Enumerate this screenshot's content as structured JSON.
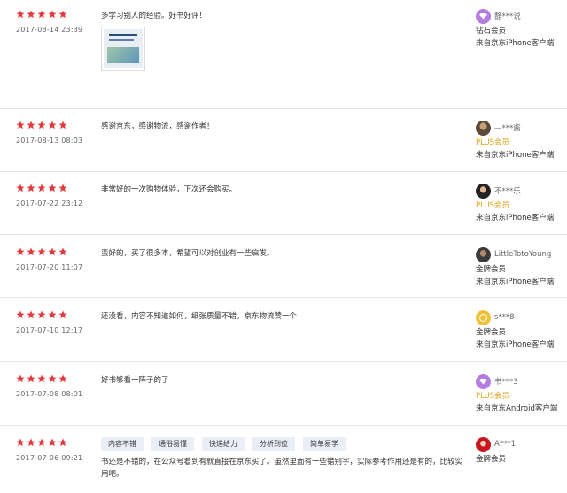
{
  "colors": {
    "star": "#e4393c",
    "plus": "#e3a120",
    "tag_bg": "#eaeef7"
  },
  "reviews": [
    {
      "stars": 5,
      "date": "2017-08-14 23:39",
      "content": "多学习别人的经验。好书好评！",
      "has_image": true,
      "user": {
        "name": "静***说",
        "avatar": "diamond-icon",
        "level": "钻石会员",
        "device": "来自京东iPhone客户端"
      }
    },
    {
      "stars": 5,
      "date": "2017-08-13 08:03",
      "content": "感谢京东，感谢物流，感谢作者！",
      "user": {
        "name": "—***酱",
        "avatar": "user-photo",
        "level": "PLUS会员",
        "device": "来自京东iPhone客户端"
      }
    },
    {
      "stars": 5,
      "date": "2017-07-22 23:12",
      "content": "非常好的一次购物体验，下次还会购买。",
      "user": {
        "name": "不***乐",
        "avatar": "user-photo",
        "level": "PLUS会员",
        "device": "来自京东iPhone客户端"
      }
    },
    {
      "stars": 5,
      "date": "2017-07-20 11:07",
      "content": "蛮好的，买了很多本，希望可以对创业有一些启发。",
      "user": {
        "name": "LittleTotoYoung",
        "avatar": "user-photo",
        "level": "金牌会员",
        "device": "来自京东iPhone客户端"
      }
    },
    {
      "stars": 5,
      "date": "2017-07-10 12:17",
      "content": "还没看，内容不知道如何，纸张质量不错，京东物流赞一个",
      "user": {
        "name": "s***8",
        "avatar": "gold-coin-icon",
        "level": "金牌会员",
        "device": "来自京东iPhone客户端"
      }
    },
    {
      "stars": 5,
      "date": "2017-07-08 08:01",
      "content": "好书够看一阵子的了",
      "user": {
        "name": "书***3",
        "avatar": "diamond-icon",
        "level": "PLUS会员",
        "device": "来自京东Android客户端"
      }
    },
    {
      "stars": 5,
      "date": "2017-07-06 09:21",
      "tags": [
        "内容不错",
        "通俗易懂",
        "快递给力",
        "分析到位",
        "简单易学"
      ],
      "content": "书还是不错的，在公众号看到有就直接在京东买了。虽然里面有一些错别字，实际参考作用还是有的，比较实用吧。",
      "user": {
        "name": "A***1",
        "avatar": "user-photo",
        "level": "金牌会员",
        "device": ""
      }
    }
  ]
}
